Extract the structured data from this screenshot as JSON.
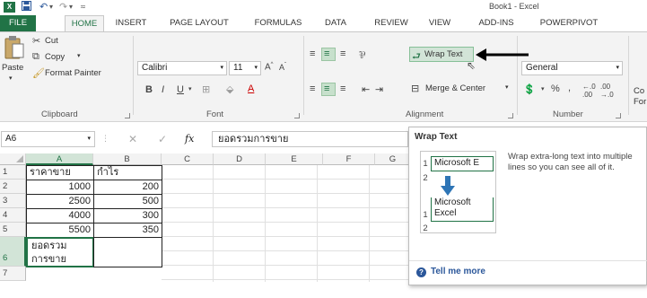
{
  "app": {
    "logo": "X",
    "title": "Book1 - Excel",
    "colors": {
      "brand": "#217346",
      "accent_light": "#d2e4d7",
      "link": "#2b579a"
    }
  },
  "quick_access": {
    "save_icon": "save-icon",
    "undo_icon": "undo-icon",
    "redo_icon": "redo-icon"
  },
  "tabs": [
    {
      "label": "FILE"
    },
    {
      "label": "HOME"
    },
    {
      "label": "INSERT"
    },
    {
      "label": "PAGE LAYOUT"
    },
    {
      "label": "FORMULAS"
    },
    {
      "label": "DATA"
    },
    {
      "label": "REVIEW"
    },
    {
      "label": "VIEW"
    },
    {
      "label": "ADD-INS"
    },
    {
      "label": "POWERPIVOT"
    }
  ],
  "ribbon": {
    "clipboard": {
      "paste": "Paste",
      "cut": "Cut",
      "copy": "Copy",
      "format_painter": "Format Painter",
      "label": "Clipboard"
    },
    "font": {
      "name": "Calibri",
      "size": "11",
      "bold": "B",
      "italic": "I",
      "underline": "U",
      "label": "Font"
    },
    "alignment": {
      "wrap_text": "Wrap Text",
      "merge": "Merge & Center",
      "label": "Alignment"
    },
    "number": {
      "format": "General",
      "percent": "%",
      "comma": ",",
      "label": "Number"
    },
    "styles": {
      "conditional": "Co",
      "format_as": "For"
    }
  },
  "formula_bar": {
    "name_box": "A6",
    "fx": "fx",
    "value": "ยอดรวมการขาย"
  },
  "grid": {
    "columns": [
      "A",
      "B",
      "C",
      "D",
      "E",
      "F",
      "G"
    ],
    "rows": [
      {
        "num": "1",
        "a": "ราคาขาย",
        "b": "กำไร"
      },
      {
        "num": "2",
        "a": "1000",
        "b": "200"
      },
      {
        "num": "3",
        "a": "2500",
        "b": "500"
      },
      {
        "num": "4",
        "a": "4000",
        "b": "300"
      },
      {
        "num": "5",
        "a": "5500",
        "b": "350"
      },
      {
        "num": "6",
        "a_line1": "ยอดรวม",
        "a_line2": "การขาย",
        "b": ""
      },
      {
        "num": "7"
      }
    ]
  },
  "tooltip": {
    "title": "Wrap Text",
    "description": "Wrap extra-long text into multiple lines so you can see all of it.",
    "before": {
      "row1": "1",
      "row2": "2",
      "cell": "Microsoft E"
    },
    "after": {
      "line1": "Microsoft",
      "line2": "Excel",
      "row1": "1",
      "row2": "2"
    },
    "tell_me": "Tell me more"
  }
}
